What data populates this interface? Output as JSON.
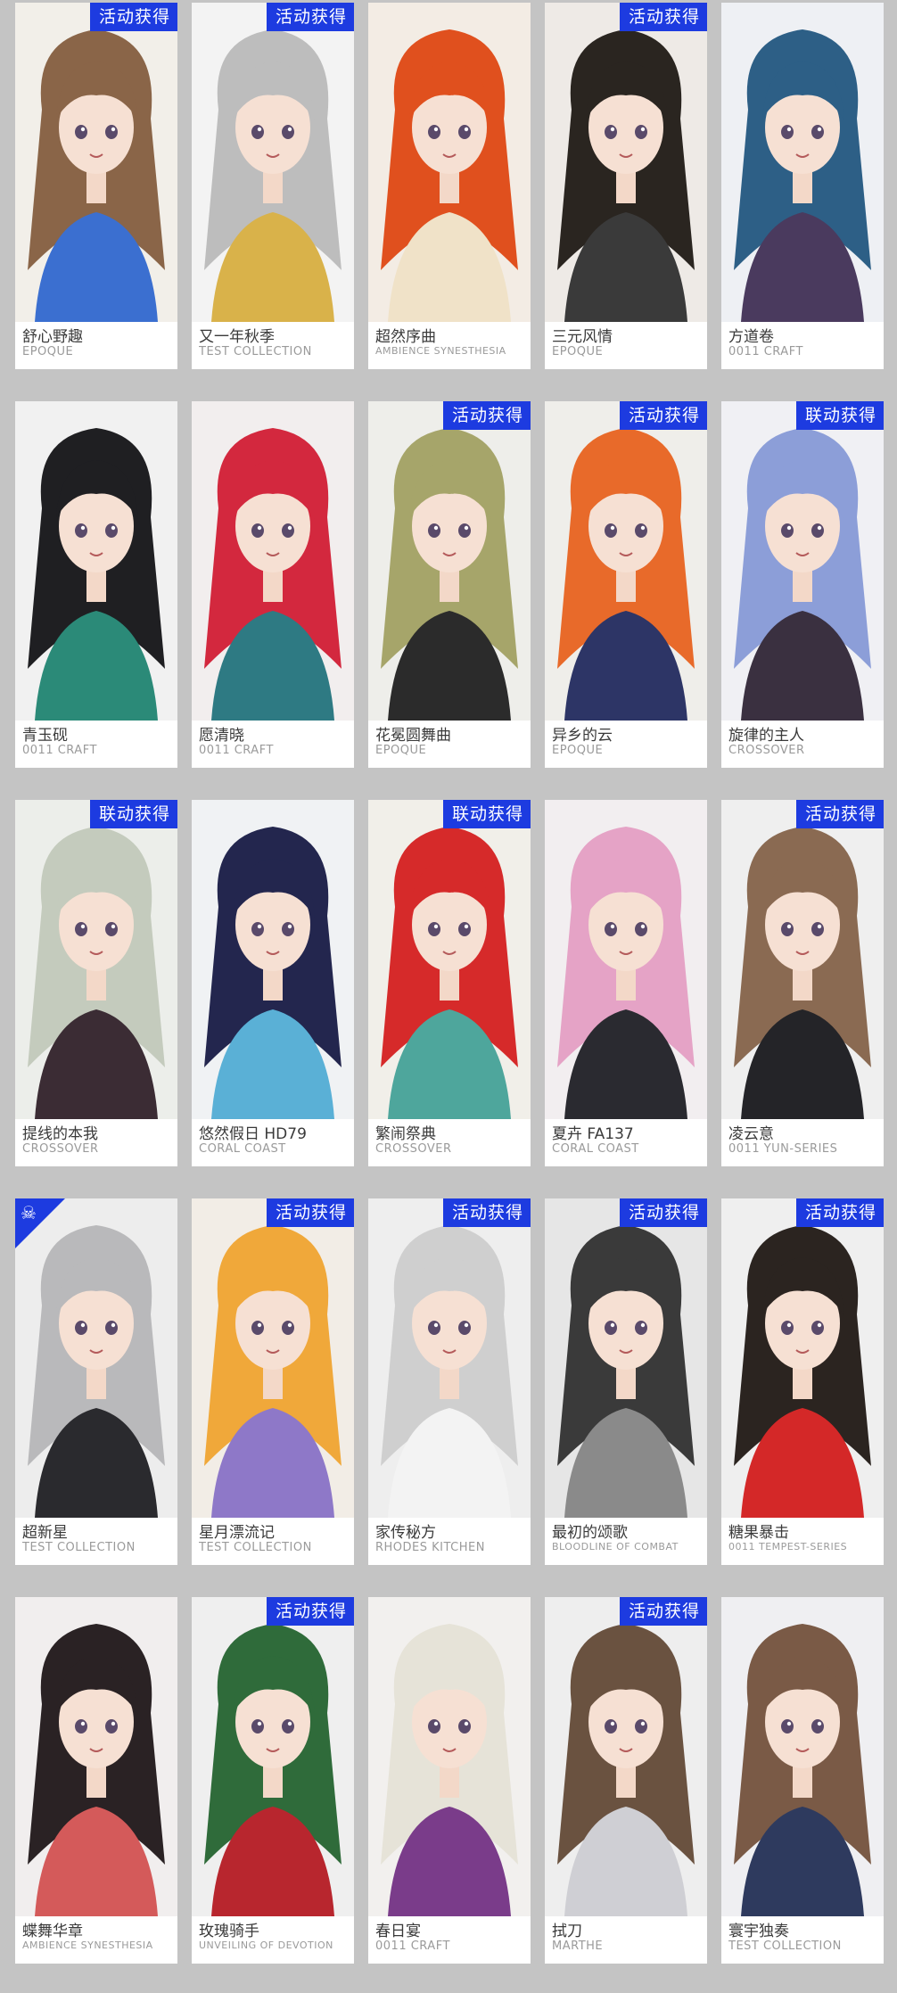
{
  "cards": [
    {
      "name": "舒心野趣",
      "brand": "EPOQUE",
      "badge": "活动获得",
      "hair": "#8a6548",
      "accent": "#3b6fd0",
      "bg": "#f2efe9"
    },
    {
      "name": "又一年秋季",
      "brand": "TEST COLLECTION",
      "badge": "活动获得",
      "hair": "#bdbdbd",
      "accent": "#d9b24a",
      "bg": "#f3f3f3"
    },
    {
      "name": "超然序曲",
      "brand": "AMBIENCE SYNESTHESIA",
      "badge": "",
      "hair": "#e0501e",
      "accent": "#f0e2c8",
      "bg": "#f3ece4"
    },
    {
      "name": "三元风情",
      "brand": "EPOQUE",
      "badge": "活动获得",
      "hair": "#2a2520",
      "accent": "#3a3a3a",
      "bg": "#eeeae6"
    },
    {
      "name": "方道卷",
      "brand": "0011 CRAFT",
      "badge": "",
      "hair": "#2d5f86",
      "accent": "#4a3a5e",
      "bg": "#eef0f4"
    },
    {
      "name": "青玉砚",
      "brand": "0011 CRAFT",
      "badge": "",
      "hair": "#1f1f22",
      "accent": "#2b8a78",
      "bg": "#f1f1f1"
    },
    {
      "name": "愿清晓",
      "brand": "0011 CRAFT",
      "badge": "",
      "hair": "#d3283e",
      "accent": "#2e7a83",
      "bg": "#f2eeee"
    },
    {
      "name": "花冕圆舞曲",
      "brand": "EPOQUE",
      "badge": "活动获得",
      "hair": "#a6a56a",
      "accent": "#2b2b2b",
      "bg": "#eeeeea"
    },
    {
      "name": "异乡的云",
      "brand": "EPOQUE",
      "badge": "活动获得",
      "hair": "#e86a2a",
      "accent": "#2d3566",
      "bg": "#efeeea"
    },
    {
      "name": "旋律的主人",
      "brand": "CROSSOVER",
      "badge": "联动获得",
      "hair": "#8c9ed8",
      "accent": "#3a3040",
      "bg": "#f0f0f4"
    },
    {
      "name": "提线的本我",
      "brand": "CROSSOVER",
      "badge": "联动获得",
      "hair": "#c4cbbd",
      "accent": "#3b2c34",
      "bg": "#eceeea"
    },
    {
      "name": "悠然假日 HD79",
      "brand": "CORAL COAST",
      "badge": "",
      "hair": "#23264e",
      "accent": "#5ab0d6",
      "bg": "#f0f2f4"
    },
    {
      "name": "繁闹祭典",
      "brand": "CROSSOVER",
      "badge": "联动获得",
      "hair": "#d62a2a",
      "accent": "#4ea69c",
      "bg": "#f1efe9"
    },
    {
      "name": "夏卉 FA137",
      "brand": "CORAL COAST",
      "badge": "",
      "hair": "#e5a3c6",
      "accent": "#2a2a30",
      "bg": "#f2eef0"
    },
    {
      "name": "凌云意",
      "brand": "0011 YUN-SERIES",
      "badge": "活动获得",
      "hair": "#8a6a52",
      "accent": "#242428",
      "bg": "#efefef"
    },
    {
      "name": "超新星",
      "brand": "TEST COLLECTION",
      "badge": "",
      "hair": "#b9b9bb",
      "accent": "#2a2a2e",
      "bg": "#ededed",
      "corner": true
    },
    {
      "name": "星月漂流记",
      "brand": "TEST COLLECTION",
      "badge": "活动获得",
      "hair": "#f0a83a",
      "accent": "#8e78c8",
      "bg": "#f2ede6"
    },
    {
      "name": "家传秘方",
      "brand": "RHODES KITCHEN",
      "badge": "活动获得",
      "hair": "#cfcfcf",
      "accent": "#f3f3f3",
      "bg": "#eeeeee"
    },
    {
      "name": "最初的颂歌",
      "brand": "BLOODLINE OF COMBAT",
      "badge": "活动获得",
      "hair": "#3a3a3a",
      "accent": "#8a8a8a",
      "bg": "#e6e6e6"
    },
    {
      "name": "糖果暴击",
      "brand": "0011 TEMPEST-SERIES",
      "badge": "活动获得",
      "hair": "#2b2420",
      "accent": "#d42828",
      "bg": "#efefef"
    },
    {
      "name": "蝶舞华章",
      "brand": "AMBIENCE SYNESTHESIA",
      "badge": "",
      "hair": "#2a2224",
      "accent": "#d45a5a",
      "bg": "#f1eeee"
    },
    {
      "name": "玫瑰骑手",
      "brand": "UNVEILING OF DEVOTION",
      "badge": "活动获得",
      "hair": "#2f6b3a",
      "accent": "#b8262e",
      "bg": "#efefef"
    },
    {
      "name": "春日宴",
      "brand": "0011 CRAFT",
      "badge": "",
      "hair": "#e6e3d8",
      "accent": "#7a3c8a",
      "bg": "#f2f0ee"
    },
    {
      "name": "拭刀",
      "brand": "MARTHE",
      "badge": "活动获得",
      "hair": "#6a5240",
      "accent": "#cfcfd4",
      "bg": "#eeeeee"
    },
    {
      "name": "寰宇独奏",
      "brand": "TEST COLLECTION",
      "badge": "",
      "hair": "#7a5a46",
      "accent": "#2e3a5e",
      "bg": "#efeff2"
    }
  ]
}
